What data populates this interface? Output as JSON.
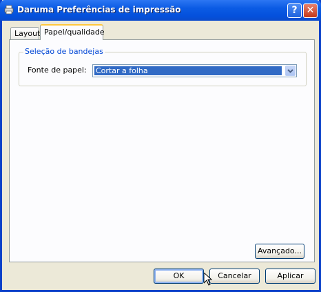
{
  "window": {
    "title": "Daruma Preferências de impressão"
  },
  "titlebar": {
    "help_label": "?",
    "close_label": "✕"
  },
  "tabs": [
    {
      "label": "Layout",
      "selected": false
    },
    {
      "label": "Papel/qualidade",
      "selected": true
    }
  ],
  "paper_section": {
    "group_title": "Seleção de bandejas",
    "source_label": "Fonte de papel:",
    "source_value": "Cortar a folha"
  },
  "buttons": {
    "advanced": "Avançado...",
    "ok": "OK",
    "cancel": "Cancelar",
    "apply": "Aplicar"
  },
  "colors": {
    "titlebar": "#0A4BCB",
    "selection": "#316AC5",
    "group_title": "#0046D5",
    "tab_highlight": "#FFC83C"
  }
}
